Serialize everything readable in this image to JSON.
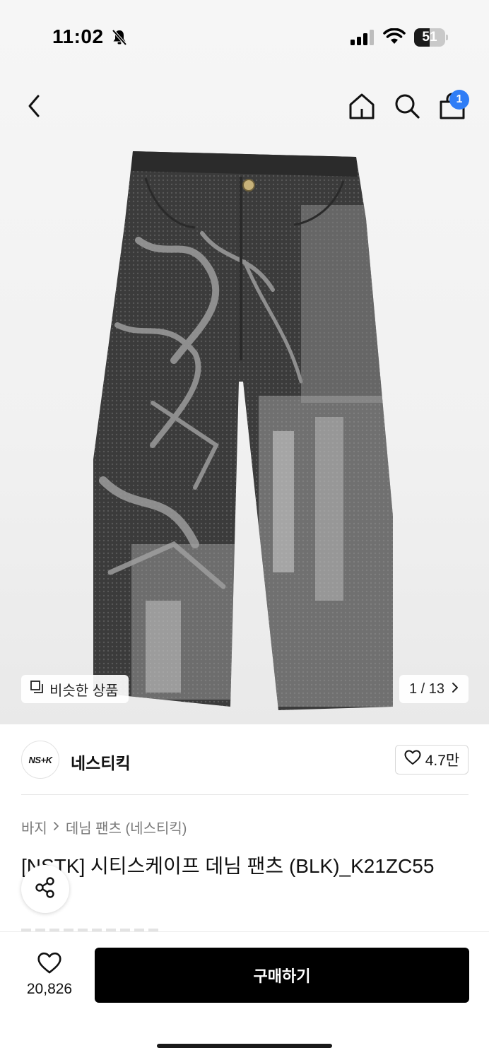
{
  "status_bar": {
    "time": "11:02",
    "battery_level": "51",
    "battery_fraction": 0.51,
    "icons": [
      "bell-slash-icon",
      "cellular-signal-icon",
      "wifi-icon",
      "battery-icon"
    ]
  },
  "nav": {
    "icons": [
      "chevron-left-icon",
      "home-icon",
      "search-icon",
      "shopping-bag-icon"
    ],
    "cart_badge": "1",
    "accent_color": "#2f7df6"
  },
  "gallery": {
    "similar_label": "비슷한 상품",
    "pager": "1 / 13"
  },
  "brand": {
    "logo_text": "NS+K",
    "name": "네스티킥",
    "like_count": "4.7만"
  },
  "breadcrumb": {
    "category": "바지",
    "subcategory": "데님 팬츠 (네스티킥)"
  },
  "product": {
    "title": "[NSTK] 시티스케이프 데님 팬츠 (BLK)_K21ZC55"
  },
  "bottom_bar": {
    "wish_count": "20,826",
    "buy_label": "구매하기",
    "buy_color": "#000000"
  }
}
